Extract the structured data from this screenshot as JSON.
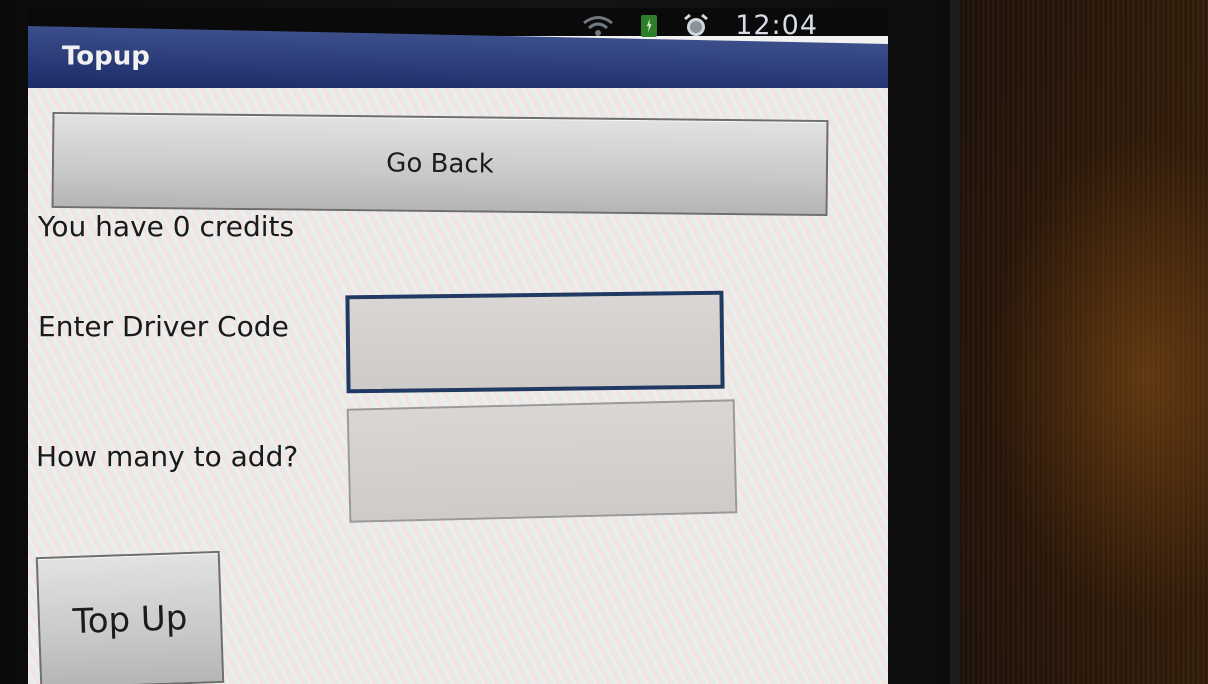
{
  "status_bar": {
    "time": "12:04",
    "icons": [
      "wifi-icon",
      "battery-charging-icon",
      "alarm-icon"
    ]
  },
  "app": {
    "title": "Topup"
  },
  "buttons": {
    "go_back": "Go Back",
    "top_up": "Top Up"
  },
  "info": {
    "credits_text": "You have 0 credits"
  },
  "form": {
    "driver_code_label": "Enter Driver Code",
    "driver_code_value": "",
    "amount_label": "How many to add?",
    "amount_value": ""
  },
  "colors": {
    "title_bar": "#2a3b78",
    "focused_field_border": "#213a63",
    "button_face": "#c9c9c9"
  }
}
